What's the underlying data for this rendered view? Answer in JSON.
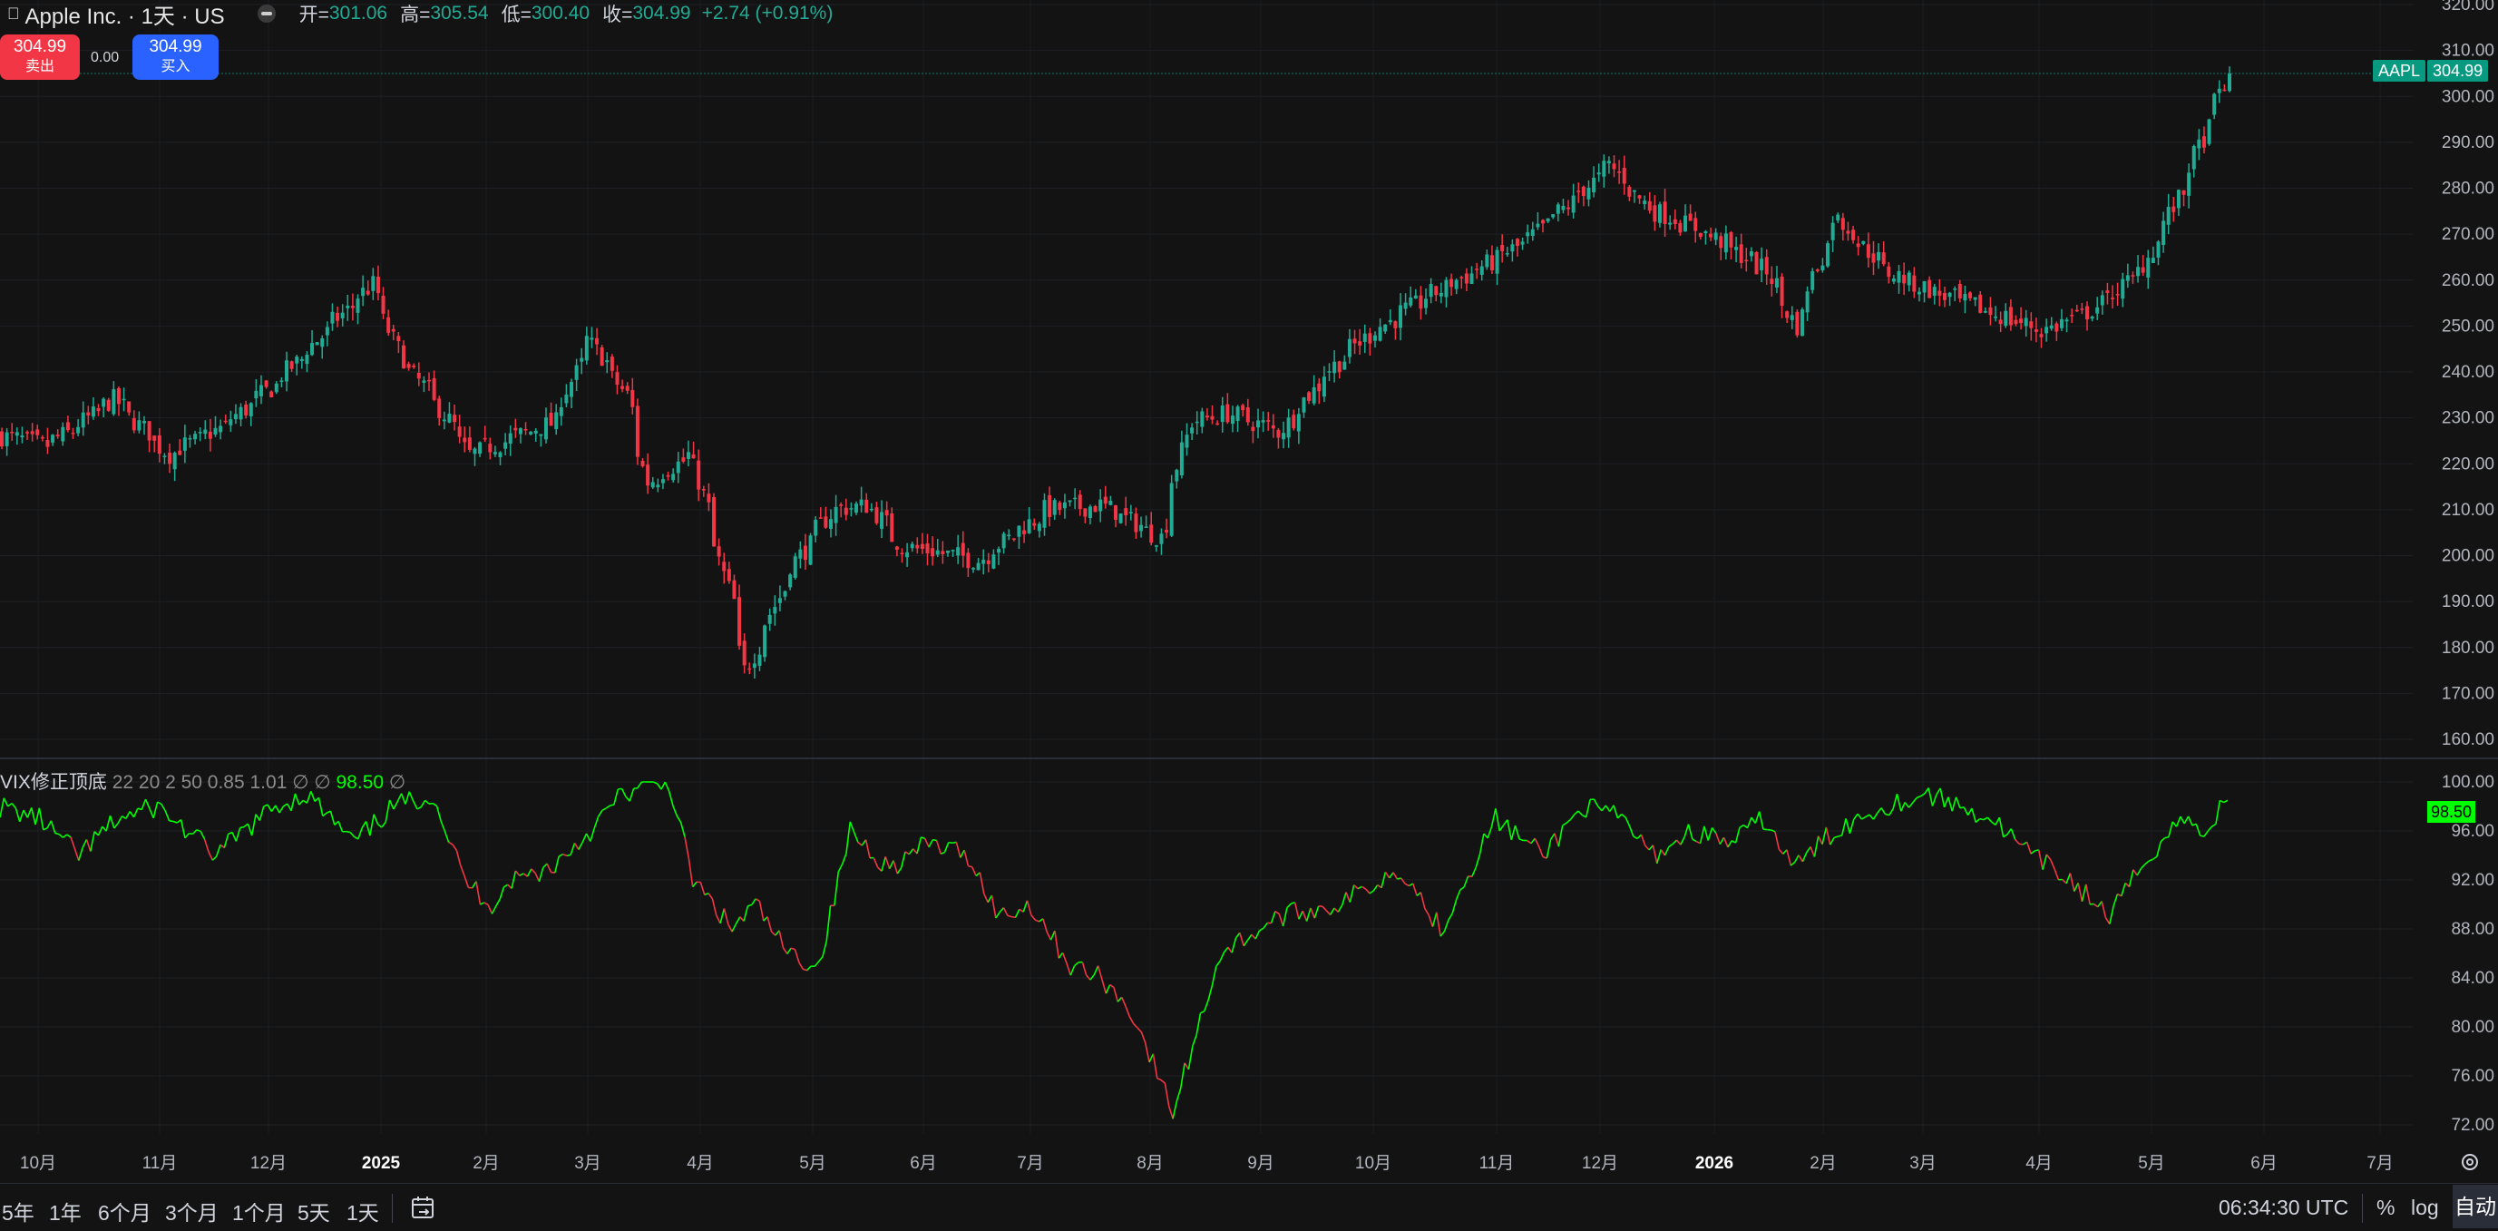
{
  "header": {
    "apple_icon": "",
    "title": "Apple Inc. · 1天 · US",
    "ohlc": [
      {
        "k": "开=",
        "v": "301.06"
      },
      {
        "k": "高=",
        "v": "305.54"
      },
      {
        "k": "低=",
        "v": "300.40"
      },
      {
        "k": "收=",
        "v": "304.99"
      }
    ],
    "change": "+2.74 (+0.91%)"
  },
  "trade": {
    "sell_price": "304.99",
    "sell_label": "卖出",
    "spread": "0.00",
    "buy_price": "304.99",
    "buy_label": "买入"
  },
  "price_tag": {
    "symbol": "AAPL",
    "price": "304.99"
  },
  "indicator": {
    "name": "VIX修正顶底",
    "params": "22 20 2 50 0.85 1.01",
    "na1": "∅",
    "na2": "∅",
    "value": "98.50",
    "na3": "∅"
  },
  "price_axis": [
    "320.00",
    "310.00",
    "300.00",
    "290.00",
    "280.00",
    "270.00",
    "260.00",
    "250.00",
    "240.00",
    "230.00",
    "220.00",
    "210.00",
    "200.00",
    "190.00",
    "180.00",
    "170.00",
    "160.00"
  ],
  "ind_axis": [
    "100.00",
    "96.00",
    "92.00",
    "88.00",
    "84.00",
    "80.00",
    "76.00",
    "72.00"
  ],
  "time_axis": [
    "10月",
    "11月",
    "12月",
    "2025",
    "2月",
    "3月",
    "4月",
    "5月",
    "6月",
    "7月",
    "8月",
    "9月",
    "10月",
    "11月",
    "12月",
    "2026",
    "2月",
    "3月",
    "4月",
    "5月",
    "6月",
    "7月"
  ],
  "timeframes": [
    "5年",
    "1年",
    "6个月",
    "3个月",
    "1个月",
    "5天",
    "1天"
  ],
  "status": {
    "clock": "06:34:30 UTC",
    "percent": "%",
    "log": "log",
    "auto": "自动"
  },
  "colors": {
    "up": "#22ab94",
    "down": "#f23645",
    "ind_up": "#00ff00",
    "ind_down": "#f23645",
    "price_tag": "#089981"
  },
  "chart_data": [
    {
      "type": "candlestick",
      "series_name": "AAPL",
      "ylim": [
        160,
        320
      ],
      "last": 304.99,
      "x": [
        "2024-09-16",
        "2024-09-27",
        "2024-10-04",
        "2024-10-16",
        "2024-10-31",
        "2024-11-15",
        "2024-11-29",
        "2024-12-16",
        "2024-12-26",
        "2025-01-03",
        "2025-01-14",
        "2025-01-22",
        "2025-02-07",
        "2025-02-14",
        "2025-02-24",
        "2025-03-06",
        "2025-03-12",
        "2025-03-24",
        "2025-04-04",
        "2025-04-08",
        "2025-04-21",
        "2025-05-02",
        "2025-05-12",
        "2025-05-21",
        "2025-05-29",
        "2025-06-11",
        "2025-06-30",
        "2025-07-15",
        "2025-07-31",
        "2025-08-08",
        "2025-08-19",
        "2025-09-02",
        "2025-09-15",
        "2025-09-26",
        "2025-10-14",
        "2025-10-28",
        "2025-11-10",
        "2025-12-02",
        "2025-12-12",
        "2025-12-29",
        "2026-01-14",
        "2026-01-22",
        "2026-02-02",
        "2026-02-16",
        "2026-02-27",
        "2026-03-20",
        "2026-03-31",
        "2026-04-13",
        "2026-04-27",
        "2026-05-08",
        "2026-05-21"
      ],
      "close": [
        226,
        224,
        227,
        234,
        222,
        228,
        237,
        251,
        259,
        243,
        232,
        222,
        227,
        229,
        247,
        235,
        216,
        222,
        190,
        175,
        198,
        210,
        211,
        202,
        201,
        199,
        210,
        211,
        204,
        229,
        231,
        227,
        240,
        248,
        257,
        263,
        269,
        285,
        276,
        270,
        262,
        250,
        274,
        262,
        258,
        252,
        249,
        253,
        262,
        279,
        304.99
      ],
      "note": "approximate daily closes; OHLC bars rendered with synthetic intraday noise"
    },
    {
      "type": "line",
      "series_name": "VIX修正顶底",
      "ylim": [
        72,
        100
      ],
      "last": 98.5,
      "x_index": [
        0,
        10,
        20,
        30,
        40,
        55,
        62,
        70,
        78,
        90,
        100,
        110,
        118,
        125,
        130,
        140,
        150,
        158,
        170,
        176,
        186,
        192,
        200,
        208,
        216,
        226,
        236,
        246,
        254,
        262,
        272,
        280,
        288,
        298,
        310,
        325,
        340,
        356,
        366,
        380,
        392,
        402,
        412,
        420,
        430,
        440,
        448,
        456,
        466,
        478,
        490,
        506,
        516,
        526,
        536,
        546,
        554,
        560,
        566
      ],
      "values": [
        98,
        97,
        94,
        97,
        98,
        94,
        96,
        98,
        99,
        95,
        98,
        99,
        92,
        90,
        92,
        93,
        96,
        99,
        100,
        92,
        88,
        90,
        86,
        85,
        96,
        93,
        95,
        94,
        89,
        90,
        85,
        84,
        81,
        73,
        86,
        89,
        90,
        93,
        88,
        97,
        94,
        98,
        97,
        94,
        96,
        95,
        97,
        93,
        96,
        98,
        99,
        97,
        94,
        92,
        89,
        94,
        97,
        96,
        98.5
      ]
    }
  ]
}
